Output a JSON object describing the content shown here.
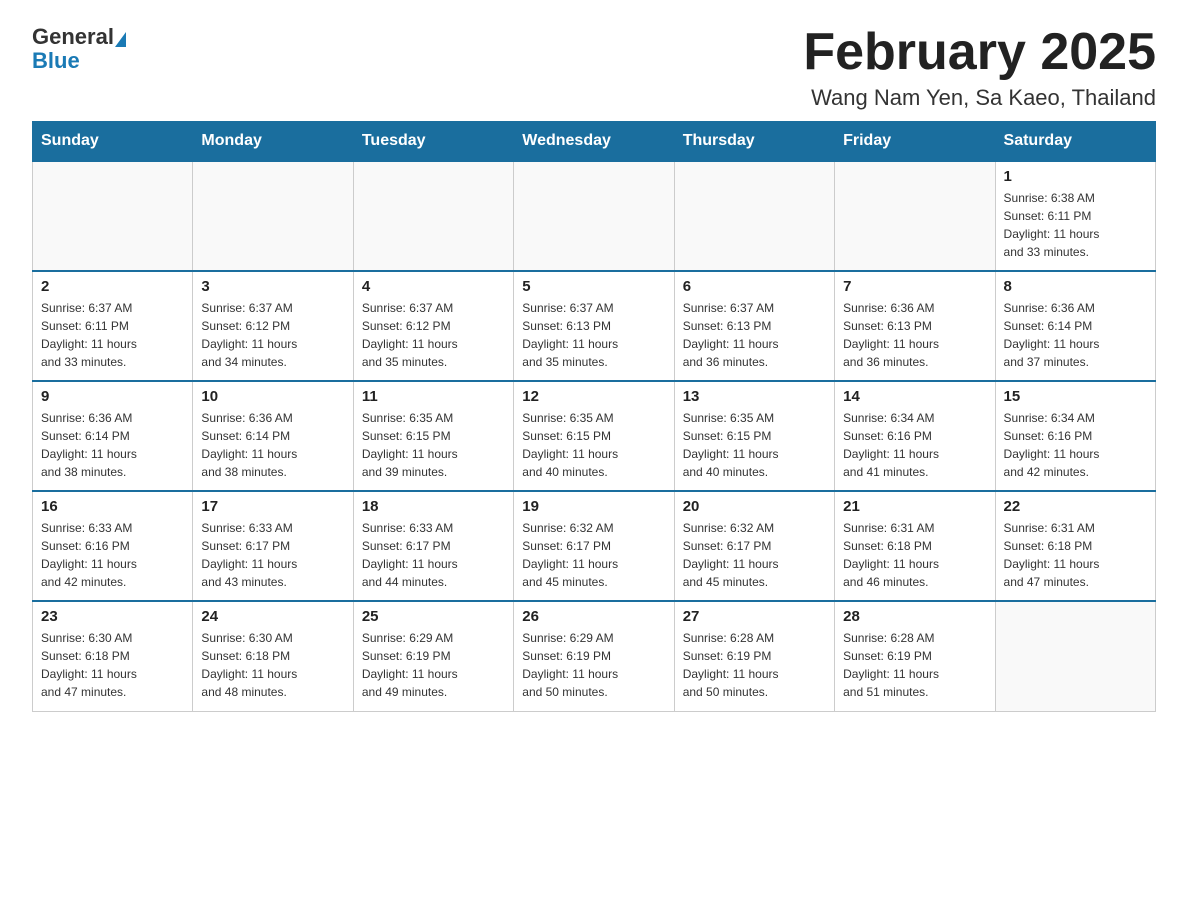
{
  "header": {
    "title": "February 2025",
    "subtitle": "Wang Nam Yen, Sa Kaeo, Thailand",
    "logo_general": "General",
    "logo_blue": "Blue"
  },
  "calendar": {
    "days_of_week": [
      "Sunday",
      "Monday",
      "Tuesday",
      "Wednesday",
      "Thursday",
      "Friday",
      "Saturday"
    ],
    "weeks": [
      [
        {
          "day": "",
          "info": ""
        },
        {
          "day": "",
          "info": ""
        },
        {
          "day": "",
          "info": ""
        },
        {
          "day": "",
          "info": ""
        },
        {
          "day": "",
          "info": ""
        },
        {
          "day": "",
          "info": ""
        },
        {
          "day": "1",
          "info": "Sunrise: 6:38 AM\nSunset: 6:11 PM\nDaylight: 11 hours\nand 33 minutes."
        }
      ],
      [
        {
          "day": "2",
          "info": "Sunrise: 6:37 AM\nSunset: 6:11 PM\nDaylight: 11 hours\nand 33 minutes."
        },
        {
          "day": "3",
          "info": "Sunrise: 6:37 AM\nSunset: 6:12 PM\nDaylight: 11 hours\nand 34 minutes."
        },
        {
          "day": "4",
          "info": "Sunrise: 6:37 AM\nSunset: 6:12 PM\nDaylight: 11 hours\nand 35 minutes."
        },
        {
          "day": "5",
          "info": "Sunrise: 6:37 AM\nSunset: 6:13 PM\nDaylight: 11 hours\nand 35 minutes."
        },
        {
          "day": "6",
          "info": "Sunrise: 6:37 AM\nSunset: 6:13 PM\nDaylight: 11 hours\nand 36 minutes."
        },
        {
          "day": "7",
          "info": "Sunrise: 6:36 AM\nSunset: 6:13 PM\nDaylight: 11 hours\nand 36 minutes."
        },
        {
          "day": "8",
          "info": "Sunrise: 6:36 AM\nSunset: 6:14 PM\nDaylight: 11 hours\nand 37 minutes."
        }
      ],
      [
        {
          "day": "9",
          "info": "Sunrise: 6:36 AM\nSunset: 6:14 PM\nDaylight: 11 hours\nand 38 minutes."
        },
        {
          "day": "10",
          "info": "Sunrise: 6:36 AM\nSunset: 6:14 PM\nDaylight: 11 hours\nand 38 minutes."
        },
        {
          "day": "11",
          "info": "Sunrise: 6:35 AM\nSunset: 6:15 PM\nDaylight: 11 hours\nand 39 minutes."
        },
        {
          "day": "12",
          "info": "Sunrise: 6:35 AM\nSunset: 6:15 PM\nDaylight: 11 hours\nand 40 minutes."
        },
        {
          "day": "13",
          "info": "Sunrise: 6:35 AM\nSunset: 6:15 PM\nDaylight: 11 hours\nand 40 minutes."
        },
        {
          "day": "14",
          "info": "Sunrise: 6:34 AM\nSunset: 6:16 PM\nDaylight: 11 hours\nand 41 minutes."
        },
        {
          "day": "15",
          "info": "Sunrise: 6:34 AM\nSunset: 6:16 PM\nDaylight: 11 hours\nand 42 minutes."
        }
      ],
      [
        {
          "day": "16",
          "info": "Sunrise: 6:33 AM\nSunset: 6:16 PM\nDaylight: 11 hours\nand 42 minutes."
        },
        {
          "day": "17",
          "info": "Sunrise: 6:33 AM\nSunset: 6:17 PM\nDaylight: 11 hours\nand 43 minutes."
        },
        {
          "day": "18",
          "info": "Sunrise: 6:33 AM\nSunset: 6:17 PM\nDaylight: 11 hours\nand 44 minutes."
        },
        {
          "day": "19",
          "info": "Sunrise: 6:32 AM\nSunset: 6:17 PM\nDaylight: 11 hours\nand 45 minutes."
        },
        {
          "day": "20",
          "info": "Sunrise: 6:32 AM\nSunset: 6:17 PM\nDaylight: 11 hours\nand 45 minutes."
        },
        {
          "day": "21",
          "info": "Sunrise: 6:31 AM\nSunset: 6:18 PM\nDaylight: 11 hours\nand 46 minutes."
        },
        {
          "day": "22",
          "info": "Sunrise: 6:31 AM\nSunset: 6:18 PM\nDaylight: 11 hours\nand 47 minutes."
        }
      ],
      [
        {
          "day": "23",
          "info": "Sunrise: 6:30 AM\nSunset: 6:18 PM\nDaylight: 11 hours\nand 47 minutes."
        },
        {
          "day": "24",
          "info": "Sunrise: 6:30 AM\nSunset: 6:18 PM\nDaylight: 11 hours\nand 48 minutes."
        },
        {
          "day": "25",
          "info": "Sunrise: 6:29 AM\nSunset: 6:19 PM\nDaylight: 11 hours\nand 49 minutes."
        },
        {
          "day": "26",
          "info": "Sunrise: 6:29 AM\nSunset: 6:19 PM\nDaylight: 11 hours\nand 50 minutes."
        },
        {
          "day": "27",
          "info": "Sunrise: 6:28 AM\nSunset: 6:19 PM\nDaylight: 11 hours\nand 50 minutes."
        },
        {
          "day": "28",
          "info": "Sunrise: 6:28 AM\nSunset: 6:19 PM\nDaylight: 11 hours\nand 51 minutes."
        },
        {
          "day": "",
          "info": ""
        }
      ]
    ]
  }
}
